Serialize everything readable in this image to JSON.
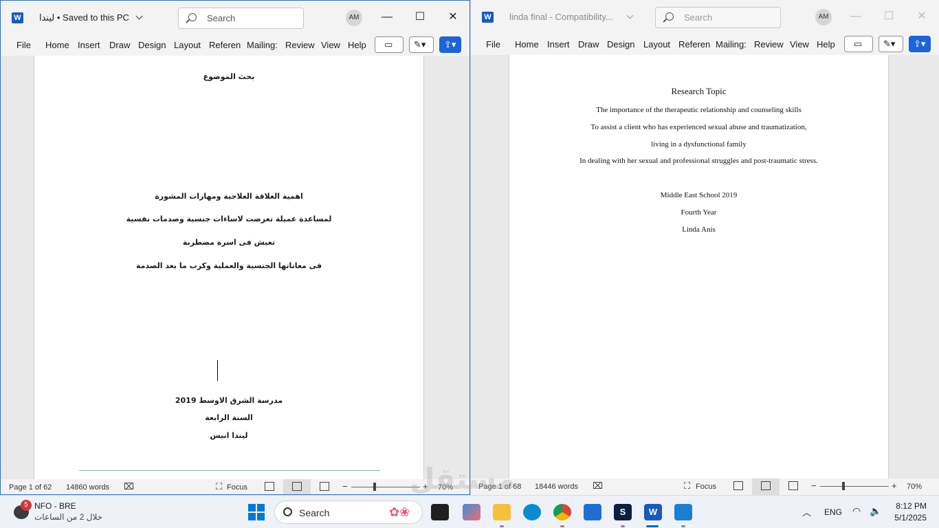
{
  "left_window": {
    "app_badge": "W",
    "title": "ليندا",
    "saved_status": "Saved to this PC",
    "search_placeholder": "Search",
    "avatar": "AM",
    "tabs": [
      "File",
      "Home",
      "Insert",
      "Draw",
      "Design",
      "Layout",
      "Referen",
      "Mailing:",
      "Review",
      "View",
      "Help"
    ],
    "doc_lines": {
      "top": "بحث الموضوع",
      "l1": "اهمية العلاقة العلاجية ومهارات المشورة",
      "l2": "لمساعدة عميلة تعرضت لاساءات جنسية وصدمات نفسية",
      "l3": "تعيش فى اسرة مضطربة",
      "l4": "فى معاناتها الجنسية والعملية وكرب ما بعد الصدمة",
      "s1": "مدرسة الشرق الاوسط 2019",
      "s2": "السنة الرابعة",
      "s3": "ليندا انيس"
    },
    "status": {
      "page": "Page 1 of 62",
      "words": "14860 words",
      "focus": "Focus",
      "zoom_minus": "−",
      "zoom_plus": "+",
      "zoom": "70%"
    }
  },
  "right_window": {
    "app_badge": "W",
    "title": "linda final  -  Compatibility...",
    "search_placeholder": "Search",
    "avatar": "AM",
    "tabs": [
      "File",
      "Home",
      "Insert",
      "Draw",
      "Design",
      "Layout",
      "Referen",
      "Mailing:",
      "Review",
      "View",
      "Help"
    ],
    "doc_lines": {
      "title": "Research Topic",
      "l1": "The importance of the therapeutic relationship and counseling skills",
      "l2": "To assist a client who has experienced sexual abuse and traumatization,",
      "l3": "living in a dysfunctional family",
      "l4": "In dealing with her sexual and professional struggles and post-traumatic stress.",
      "s1": "Middle East School 2019",
      "s2": "Fourth Year",
      "s3": "Linda Anis"
    },
    "status": {
      "page": "Page 1 of 68",
      "words": "18446 words",
      "focus": "Focus",
      "zoom_minus": "−",
      "zoom_plus": "+",
      "zoom": "70%"
    }
  },
  "taskbar": {
    "weather_badge": "5",
    "weather_title": "NFO - BRE",
    "weather_sub": "خلال 2 من الساعات",
    "search": "Search",
    "lang": "ENG",
    "time": "8:12 PM",
    "date": "5/1/2025"
  },
  "watermark": "مستقل",
  "colors": {
    "accent": "#1c64d9",
    "word_blue": "#185abd",
    "active_border": "#2b6fc6"
  }
}
